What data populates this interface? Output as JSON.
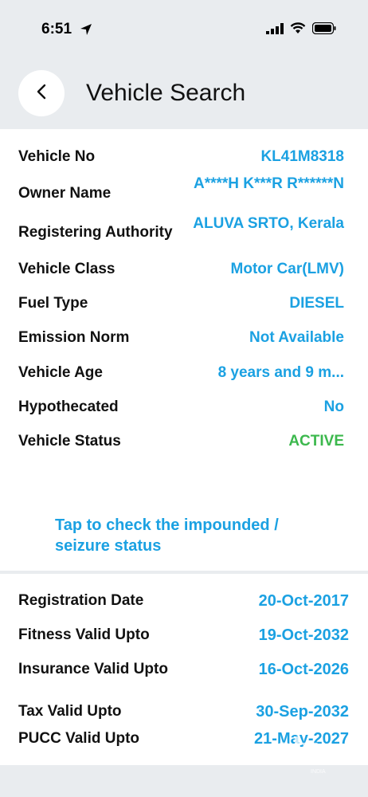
{
  "status_bar": {
    "time": "6:51"
  },
  "header": {
    "title": "Vehicle Search"
  },
  "details": [
    {
      "label": "Vehicle No",
      "value": "KL41M8318"
    },
    {
      "label": "Owner Name",
      "value": "A****H K***R R******N"
    },
    {
      "label": "Registering Authority",
      "value": "ALUVA SRTO, Kerala"
    },
    {
      "label": "Vehicle Class",
      "value": "Motor Car(LMV)"
    },
    {
      "label": "Fuel Type",
      "value": "DIESEL"
    },
    {
      "label": "Emission Norm",
      "value": "Not Available"
    },
    {
      "label": "Vehicle Age",
      "value": "8 years and 9 m..."
    },
    {
      "label": "Hypothecated",
      "value": "No"
    },
    {
      "label": "Vehicle Status",
      "value": "ACTIVE"
    }
  ],
  "impound_link": "Tap to check the impounded / seizure status",
  "validity": [
    {
      "label": "Registration Date",
      "value": "20-Oct-2017"
    },
    {
      "label": "Fitness Valid Upto",
      "value": "19-Oct-2032"
    },
    {
      "label": "Insurance Valid Upto",
      "value": "16-Oct-2026"
    },
    {
      "label": "Tax Valid Upto",
      "value": "30-Sep-2032"
    },
    {
      "label": "PUCC Valid Upto",
      "value": "21-May-2027"
    }
  ],
  "watermark": {
    "logo_text": "olx",
    "sub_text": "INDIA"
  },
  "colors": {
    "accent": "#1ba1e2",
    "active": "#3cb84d",
    "background": "#e9ecef"
  }
}
